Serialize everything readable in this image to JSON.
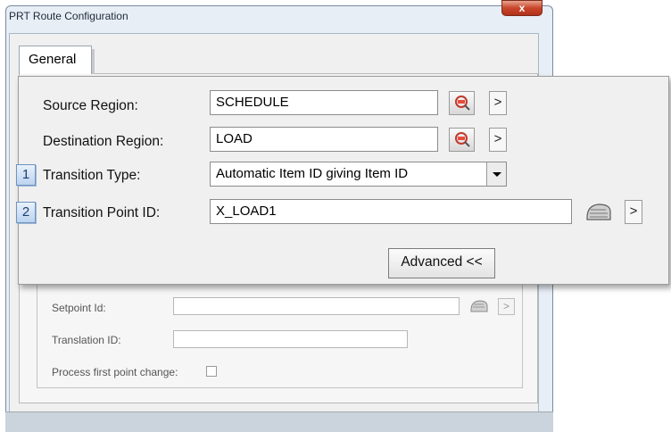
{
  "window": {
    "title": "PRT Route Configuration",
    "close_symbol": "x"
  },
  "tabs": [
    {
      "label": "General"
    }
  ],
  "form": {
    "source_region": {
      "label": "Source Region:",
      "value": "SCHEDULE"
    },
    "destination_region": {
      "label": "Destination Region:",
      "value": "LOAD"
    },
    "transition_type": {
      "label": "Transition Type:",
      "value": "Automatic Item ID giving Item ID",
      "badge": "1"
    },
    "transition_point_id": {
      "label": "Transition Point ID:",
      "value": "X_LOAD1",
      "badge": "2"
    },
    "arrow_symbol": ">",
    "advanced_button": "Advanced <<"
  },
  "advanced_section": {
    "setpoint_id": {
      "label": "Setpoint Id:",
      "value": ""
    },
    "translation_id": {
      "label": "Translation ID:",
      "value": ""
    },
    "process_first_point_change": {
      "label": "Process first point change:",
      "checked": false
    },
    "arrow_symbol": ">"
  },
  "icons": {
    "region_picker": "region-picker-icon",
    "point_browser": "point-browser-icon"
  }
}
